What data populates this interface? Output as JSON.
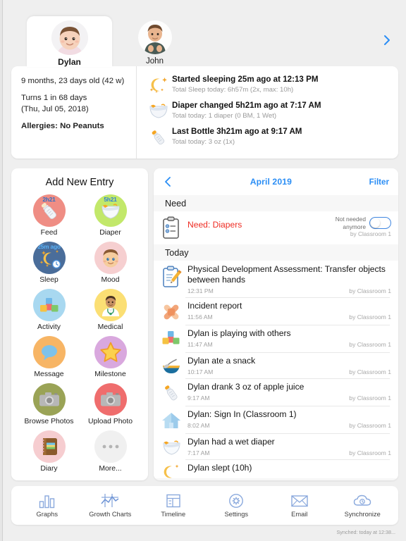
{
  "children": [
    {
      "name": "Dylan",
      "active": true,
      "avatar": "baby-avatar-dylan"
    },
    {
      "name": "John",
      "active": false,
      "avatar": "baby-avatar-john"
    }
  ],
  "next_child_icon": "chevron-right-icon",
  "info": {
    "age": "9 months, 23 days old (42 w)",
    "turns_line1": "Turns 1 in 68 days",
    "turns_line2": "(Thu, Jul 05, 2018)",
    "allergies": "Allergies: No Peanuts",
    "summaries": [
      {
        "icon": "moon-stars-icon",
        "title": "Started sleeping 25m ago at 12:13 PM",
        "sub": "Total Sleep today: 6h57m (2x, max: 10h)"
      },
      {
        "icon": "diaper-icon",
        "title": "Diaper changed 5h21m ago at 7:17 AM",
        "sub": "Total today:  1 diaper (0 BM, 1 Wet)"
      },
      {
        "icon": "bottle-icon",
        "title": "Last Bottle 3h21m ago at 9:17 AM",
        "sub": "Total today:  3 oz (1x)"
      }
    ]
  },
  "entry_panel": {
    "title": "Add New Entry",
    "items": [
      {
        "label": "Feed",
        "icon": "bottle-icon",
        "badge": "2h21",
        "circle": "#ef8d84",
        "badge_color": "#2f6fc4"
      },
      {
        "label": "Diaper",
        "icon": "diaper-icon",
        "badge": "5h21",
        "circle": "#c2e86a",
        "badge_color": "#2f7fd6"
      },
      {
        "label": "Sleep",
        "icon": "moon-stars-icon",
        "badge": "25m ago",
        "circle": "#4a6d9a",
        "badge_color": "#59b0f5"
      },
      {
        "label": "Mood",
        "icon": "baby-face-icon",
        "badge": "",
        "circle": "#f6cfd0",
        "badge_color": ""
      },
      {
        "label": "Activity",
        "icon": "blocks-icon",
        "badge": "",
        "circle": "#a8d8f0",
        "badge_color": ""
      },
      {
        "label": "Medical",
        "icon": "doctor-icon",
        "badge": "",
        "circle": "#fbdf74",
        "badge_color": ""
      },
      {
        "label": "Message",
        "icon": "chat-bubble-icon",
        "badge": "",
        "circle": "#f7b565",
        "badge_color": ""
      },
      {
        "label": "Milestone",
        "icon": "star-icon",
        "badge": "",
        "circle": "#d9a8de",
        "badge_color": ""
      },
      {
        "label": "Browse Photos",
        "icon": "camera-icon",
        "badge": "",
        "circle": "#9aa356",
        "badge_color": ""
      },
      {
        "label": "Upload Photo",
        "icon": "camera-icon",
        "badge": "",
        "circle": "#ef6d6d",
        "badge_color": ""
      },
      {
        "label": "Diary",
        "icon": "notebook-icon",
        "badge": "",
        "circle": "#f6cdd0",
        "badge_color": ""
      },
      {
        "label": "More...",
        "icon": "ellipsis-icon",
        "badge": "",
        "circle": "#f0f0f0",
        "badge_color": ""
      }
    ]
  },
  "timeline": {
    "back_icon": "chevron-left-icon",
    "month": "April 2019",
    "filter_label": "Filter",
    "sections": [
      {
        "header": "Need",
        "rows": [
          {
            "kind": "need",
            "icon": "clipboard-checklist-icon",
            "title": "Need: Diapers",
            "toggle_label_line1": "Not needed",
            "toggle_label_line2": "anymore",
            "toggle_on": false,
            "by": "by Classroom 1"
          }
        ]
      },
      {
        "header": "Today",
        "rows": [
          {
            "kind": "entry",
            "icon": "clipboard-pencil-icon",
            "title": "Physical Development Assessment: Transfer objects between hands",
            "time": "12:31 PM",
            "by": "by Classroom 1"
          },
          {
            "kind": "entry",
            "icon": "bandage-icon",
            "title": "Incident report",
            "time": "11:56 AM",
            "by": "by Classroom 1"
          },
          {
            "kind": "entry",
            "icon": "blocks-icon",
            "title": "Dylan is playing with others",
            "time": "11:47 AM",
            "by": "by Classroom 1"
          },
          {
            "kind": "entry",
            "icon": "bowl-spoon-icon",
            "title": "Dylan ate a snack",
            "time": "10:17 AM",
            "by": "by Classroom 1"
          },
          {
            "kind": "entry",
            "icon": "bottle-icon",
            "title": "Dylan drank 3 oz of apple juice",
            "time": "9:17 AM",
            "by": "by Classroom 1"
          },
          {
            "kind": "entry",
            "icon": "house-icon",
            "title": "Dylan: Sign In (Classroom 1)",
            "time": "8:02 AM",
            "by": "by Classroom 1"
          },
          {
            "kind": "entry",
            "icon": "diaper-icon",
            "title": "Dylan had a wet diaper",
            "time": "7:17 AM",
            "by": "by Classroom 1"
          },
          {
            "kind": "entry-partial",
            "icon": "moon-stars-icon",
            "title": "Dylan slept (10h)",
            "time": "",
            "by": ""
          }
        ]
      }
    ]
  },
  "toolbar": {
    "items": [
      {
        "label": "Graphs",
        "icon": "bar-chart-icon"
      },
      {
        "label": "Growth Charts",
        "icon": "growth-chart-icon"
      },
      {
        "label": "Timeline",
        "icon": "timeline-icon"
      },
      {
        "label": "Settings",
        "icon": "gear-icon"
      },
      {
        "label": "Email",
        "icon": "envelope-icon"
      },
      {
        "label": "Synchronize",
        "icon": "cloud-sync-icon"
      }
    ],
    "sync_status": "Synched: today at 12:38..."
  },
  "colors": {
    "accent_blue": "#2b8ef5",
    "need_red": "#ee2b22",
    "page_bg": "#efefef",
    "card_bg": "#ffffff"
  }
}
